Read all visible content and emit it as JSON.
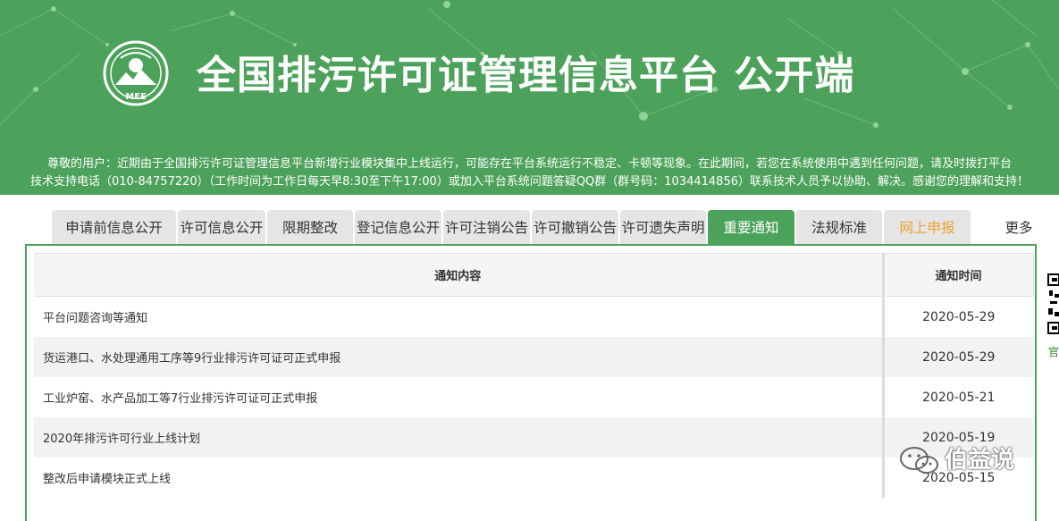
{
  "header": {
    "title": "全国排污许可证管理信息平台  公开端",
    "logo_text": "MEE",
    "bg_color": "#4ca25a"
  },
  "notice": {
    "line1": "尊敬的用户：近期由于全国排污许可证管理信息平台新增行业模块集中上线运行，可能存在平台系统运行不稳定、卡顿等现象。在此期间，若您在系统使用中遇到任何问题，请及时拨打平台",
    "line2": "技术支持电话（010-84757220）（工作时间为工作日每天早8:30至下午17:00）或加入平台系统问题答疑QQ群（群号码：1034414856）联系技术人员予以协助、解决。感谢您的理解和支持！"
  },
  "tabs": [
    {
      "label": "申请前信息公开"
    },
    {
      "label": "许可信息公开"
    },
    {
      "label": "限期整改"
    },
    {
      "label": "登记信息公开"
    },
    {
      "label": "许可注销公告"
    },
    {
      "label": "许可撤销公告"
    },
    {
      "label": "许可遗失声明"
    },
    {
      "label": "重要通知",
      "active": true
    },
    {
      "label": "法规标准"
    },
    {
      "label": "网上申报",
      "color": "#f0a030"
    },
    {
      "label": "更多"
    }
  ],
  "table": {
    "headers": [
      "通知内容",
      "通知时间"
    ],
    "rows": [
      {
        "title": "平台问题咨询等通知",
        "date": "2020-05-29"
      },
      {
        "title": "货运港口、水处理通用工序等9行业排污许可证可正式申报",
        "date": "2020-05-29"
      },
      {
        "title": "工业炉窑、水产品加工等7行业排污许可证可正式申报",
        "date": "2020-05-21"
      },
      {
        "title": "2020年排污许可行业上线计划",
        "date": "2020-05-19"
      },
      {
        "title": "整改后申请模块正式上线",
        "date": "2020-05-15"
      }
    ]
  },
  "side": {
    "qr_label": "官"
  },
  "watermark": {
    "text": "伯益说"
  }
}
